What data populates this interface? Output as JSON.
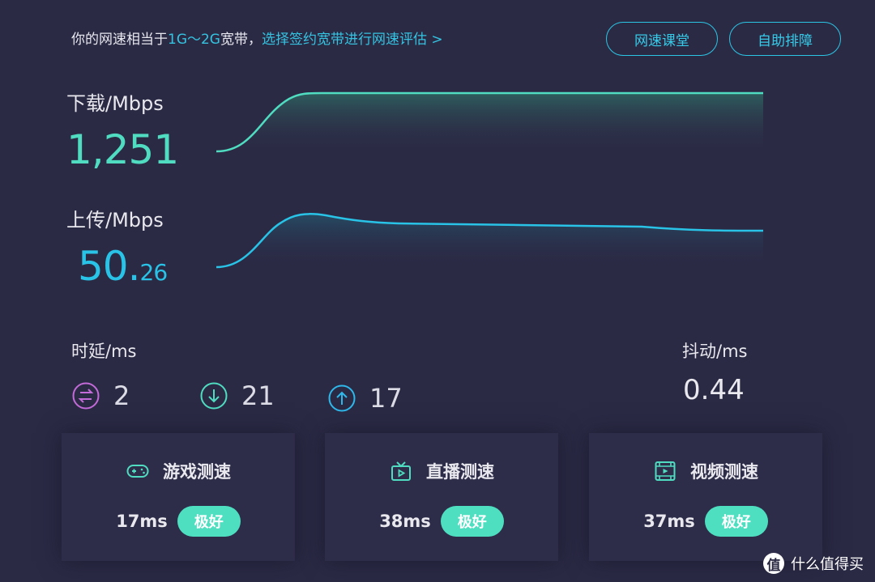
{
  "header": {
    "text_prefix": "你的网速相当于",
    "speed_range": "1G～2G",
    "text_suffix": "宽带，",
    "link_text": "选择签约宽带进行网速评估 >"
  },
  "buttons": {
    "course": "网速课堂",
    "troubleshoot": "自助排障"
  },
  "download": {
    "label": "下载/Mbps",
    "value": "1,251",
    "color": "#4fdcc0"
  },
  "upload": {
    "label": "上传/Mbps",
    "value_int": "50.",
    "value_dec": "26",
    "color": "#28c3e6"
  },
  "latency": {
    "label": "时延/ms",
    "items": [
      {
        "icon": "swap-icon",
        "value": "2",
        "color": "#c36bd8"
      },
      {
        "icon": "down-arrow-icon",
        "value": "21",
        "color": "#4fdcc0"
      },
      {
        "icon": "up-arrow-icon",
        "value": "17",
        "color": "#2fb8ea"
      }
    ]
  },
  "jitter": {
    "label": "抖动/ms",
    "value": "0.44"
  },
  "cards": [
    {
      "icon": "gamepad-icon",
      "title": "游戏测速",
      "ms": "17ms",
      "rating": "极好"
    },
    {
      "icon": "tv-icon",
      "title": "直播测速",
      "ms": "38ms",
      "rating": "极好"
    },
    {
      "icon": "video-icon",
      "title": "视频测速",
      "ms": "37ms",
      "rating": "极好"
    }
  ],
  "watermark": {
    "logo": "值",
    "text": "什么值得买"
  }
}
